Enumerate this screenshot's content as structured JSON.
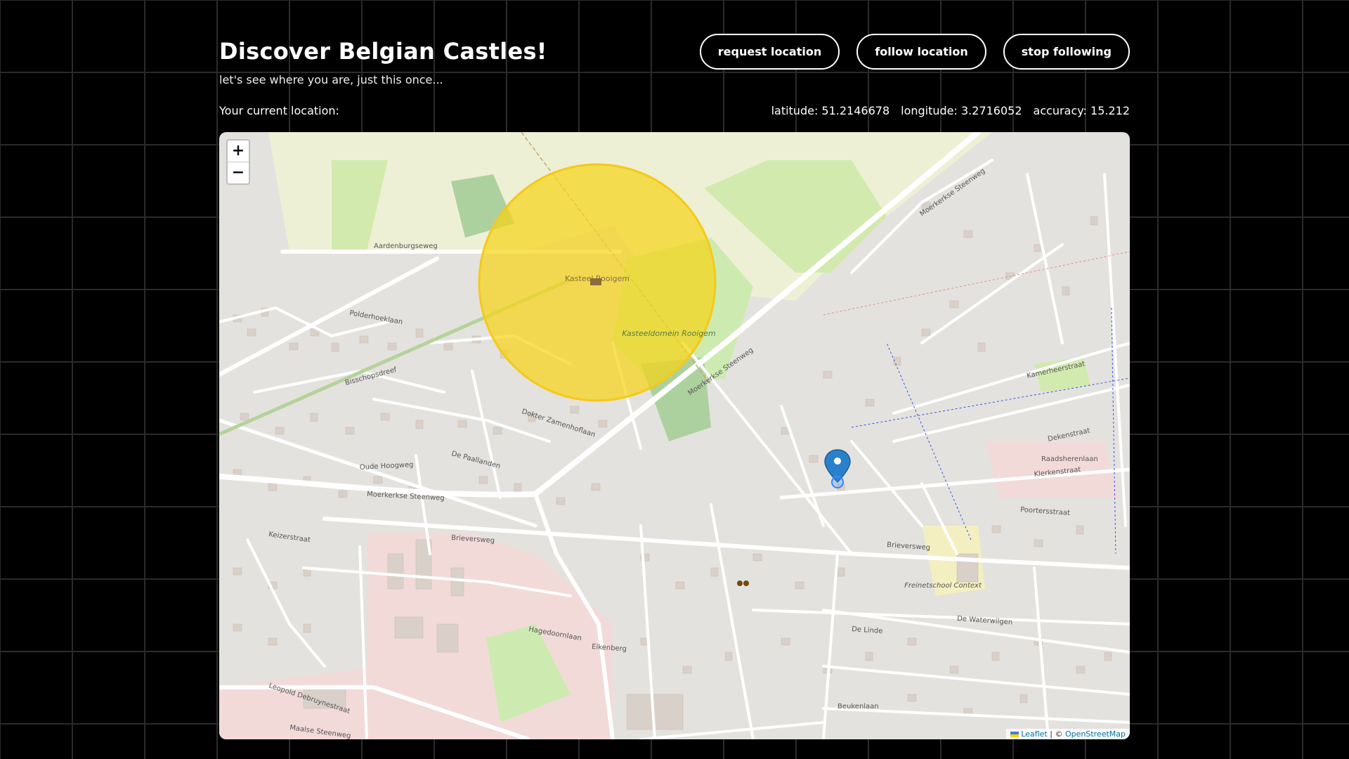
{
  "header": {
    "title": "Discover Belgian Castles!",
    "subtitle": "let's see where you are, just this once..."
  },
  "buttons": {
    "request": "request location",
    "follow": "follow location",
    "stop": "stop following"
  },
  "location": {
    "label": "Your current location:",
    "latitude": "latitude: 51.2146678",
    "longitude": "longitude: 3.2716052",
    "accuracy": "accuracy: 15.212"
  },
  "map": {
    "zoom_in": "+",
    "zoom_out": "−",
    "attribution_leaflet": "Leaflet",
    "attribution_sep": " | © ",
    "attribution_osm": "OpenStreetMap",
    "castle_label": "Kasteel Rooigem",
    "domain_label": "Kasteeldomein Rooigem",
    "school_label": "Freinetschool Context",
    "streets": {
      "aardenburgseweg": "Aardenburgseweg",
      "polderhoeklaan": "Polderhoeklaan",
      "bisschopsdreef": "Bisschopsdreef",
      "moerkerkse": "Moerkerkse Steenweg",
      "oude_hoogweg": "Oude Hoogweg",
      "brieversweg": "Brieversweg",
      "keizerstraat": "Keizerstraat",
      "beukenlaan": "Beukenlaan",
      "de_waterwilgen": "De Waterwilgen",
      "de_linde": "De Linde",
      "poortersstraat": "Poortersstraat",
      "raadsherenlaan": "Raadsherenlaan",
      "dekenstraat": "Dekenstraat",
      "kamerheerstraat": "Kamerheerstraat",
      "leopold": "Leopold Debruynestraat",
      "maalse": "Maalse Steenweg",
      "eikenberg": "Eikenberg",
      "hagedoornlaan": "Hagedoornlaan",
      "de_paallanden": "De Paallanden",
      "dokter": "Dokter Zamenhoflaan",
      "kerkhofstraat": "Klerkenstraat"
    }
  }
}
